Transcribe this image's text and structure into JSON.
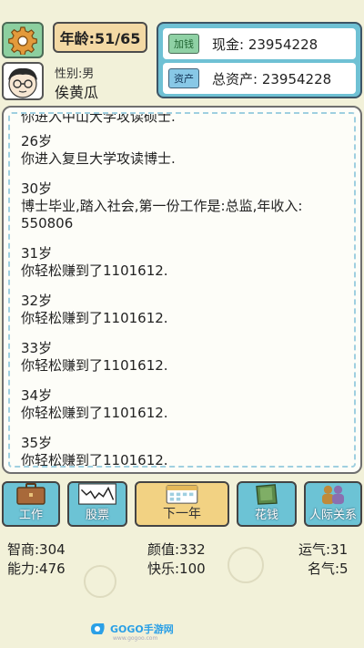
{
  "header": {
    "age_label": "年龄:51/65",
    "gender_label": "性别:男",
    "name": "俟黄瓜"
  },
  "money": {
    "cash_tag": "加钱",
    "cash_text": "现金: 23954228",
    "asset_tag": "资产",
    "asset_text": "总资产: 23954228"
  },
  "log": {
    "cut_top_line": "你进入中山大学攻读硕士.",
    "entries": [
      {
        "age": "26岁",
        "text": "你进入复旦大学攻读博士."
      },
      {
        "age": "30岁",
        "text": "博士毕业,踏入社会,第一份工作是:总监,年收入:",
        "text2": "550806"
      },
      {
        "age": "31岁",
        "text": "你轻松赚到了1101612."
      },
      {
        "age": "32岁",
        "text": "你轻松赚到了1101612."
      },
      {
        "age": "33岁",
        "text": "你轻松赚到了1101612."
      },
      {
        "age": "34岁",
        "text": "你轻松赚到了1101612."
      },
      {
        "age": "35岁",
        "text": "你轻松赚到了1101612."
      }
    ]
  },
  "actions": {
    "work": "工作",
    "stock": "股票",
    "next_year": "下一年",
    "spend": "花钱",
    "social": "人际关系"
  },
  "stats": {
    "iq": "智商:304",
    "looks": "颜值:332",
    "luck": "运气:31",
    "ability": "能力:476",
    "happiness": "快乐:100",
    "fame": "名气:5"
  },
  "watermark": {
    "brand": "GOGO手游网",
    "url": "www.gogoo.com"
  },
  "icons": {
    "settings": "gear-icon",
    "avatar": "boy-with-glasses-avatar",
    "work": "briefcase-icon",
    "stock": "stock-chart-icon",
    "next_year": "calendar-icon",
    "spend": "wallet-icon",
    "social": "people-icon"
  },
  "colors": {
    "background": "#f2f1d9",
    "panel_blue": "#6fc1d4",
    "next_button": "#f2d283",
    "tag_green": "#8fd1a5",
    "dash_blue": "#9fcfe0"
  }
}
